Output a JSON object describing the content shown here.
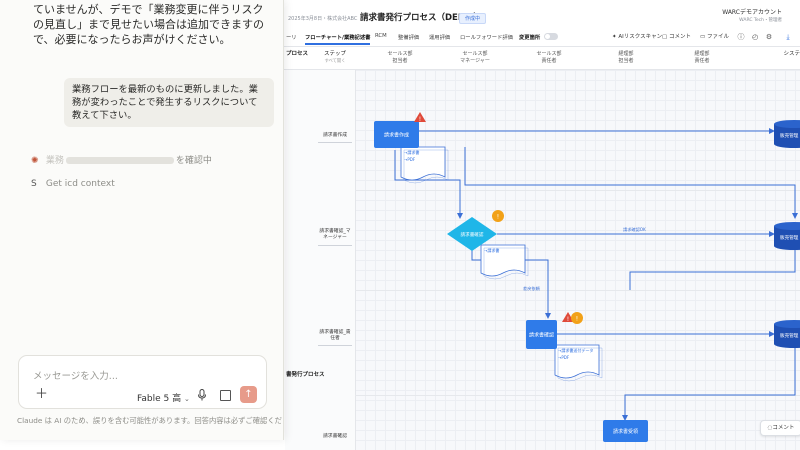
{
  "app": {
    "meta": "2025年3月8日・株式会社ABC",
    "title": "請求書発行プロセス（DEMO）",
    "badge": "作成中",
    "account_name": "WARCデモアカウント",
    "account_sub": "WARC Tech・管理者"
  },
  "nav": {
    "tabs": [
      {
        "label": "ーリ"
      },
      {
        "label": "フローチャート/業務記述書"
      },
      {
        "label": "RCM"
      },
      {
        "label": "整備評価"
      },
      {
        "label": "運用評価"
      },
      {
        "label": "ロールフォワード評価"
      }
    ],
    "active_tab": "フローチャート/業務記述書",
    "change_label": "変更箇所",
    "scan_label": "AIリスクスキャン",
    "comment_label": "コメント",
    "file_label": "ファイル"
  },
  "lane_header": {
    "process_label": "プロセス",
    "step_label": "ステップ",
    "step_sub": "すべて開く",
    "columns": [
      {
        "title": "セールス部",
        "sub": "担当者"
      },
      {
        "title": "セールス部",
        "sub": "マネージャー"
      },
      {
        "title": "セールス部",
        "sub": "責任者"
      },
      {
        "title": "経理部",
        "sub": "担当者"
      },
      {
        "title": "経理部",
        "sub": "責任者"
      },
      {
        "title": "システ",
        "sub": ""
      }
    ]
  },
  "lanes": [
    {
      "label": "請求書作成"
    },
    {
      "label": "請求書確認_マネージャー"
    },
    {
      "label": "請求書確認_責任者"
    },
    {
      "label": "請求書確認"
    }
  ],
  "side_process": "書発行プロセス",
  "flow": {
    "nodes": [
      {
        "label": "請求書作成"
      },
      {
        "label": "請求書確認"
      },
      {
        "label": "請求書確認"
      },
      {
        "label": "請求書受領"
      },
      {
        "label": "販売管理"
      },
      {
        "label": "販売管理"
      },
      {
        "label": "販売管理"
      }
    ],
    "doc_lines": [
      "→請求書",
      "→PDF",
      "→請求書",
      "→請求書送付データ",
      "→PDF"
    ],
    "edge_labels": [
      "請求確認OK",
      "差戻依頼"
    ],
    "colors": {
      "node": "#2f7be9",
      "db": "#1f4fb3",
      "warn": "#e04a3a",
      "alert": "#f2a118",
      "edge": "#3b6fd6"
    }
  },
  "comment_chip": "コメント",
  "chat": {
    "assistant_text": "ていませんが、デモで「業務変更に伴うリスクの見直し」まで見せたい場合は追加できますので、必要になったらお声がけください。",
    "user_message": "業務フローを最新のものに更新しました。業務が変わったことで発生するリスクについて教えて下さい。",
    "tool1_suffix": "を確認中",
    "tool2_label": "Get icd context",
    "tool2_glyph": "S",
    "input_placeholder": "メッセージを入力...",
    "model_name": "Fable 5",
    "model_mode": "高",
    "disclaimer": "Claude は AI のため、誤りを含む可能性があります。回答内容は必ずご確認くださ"
  }
}
